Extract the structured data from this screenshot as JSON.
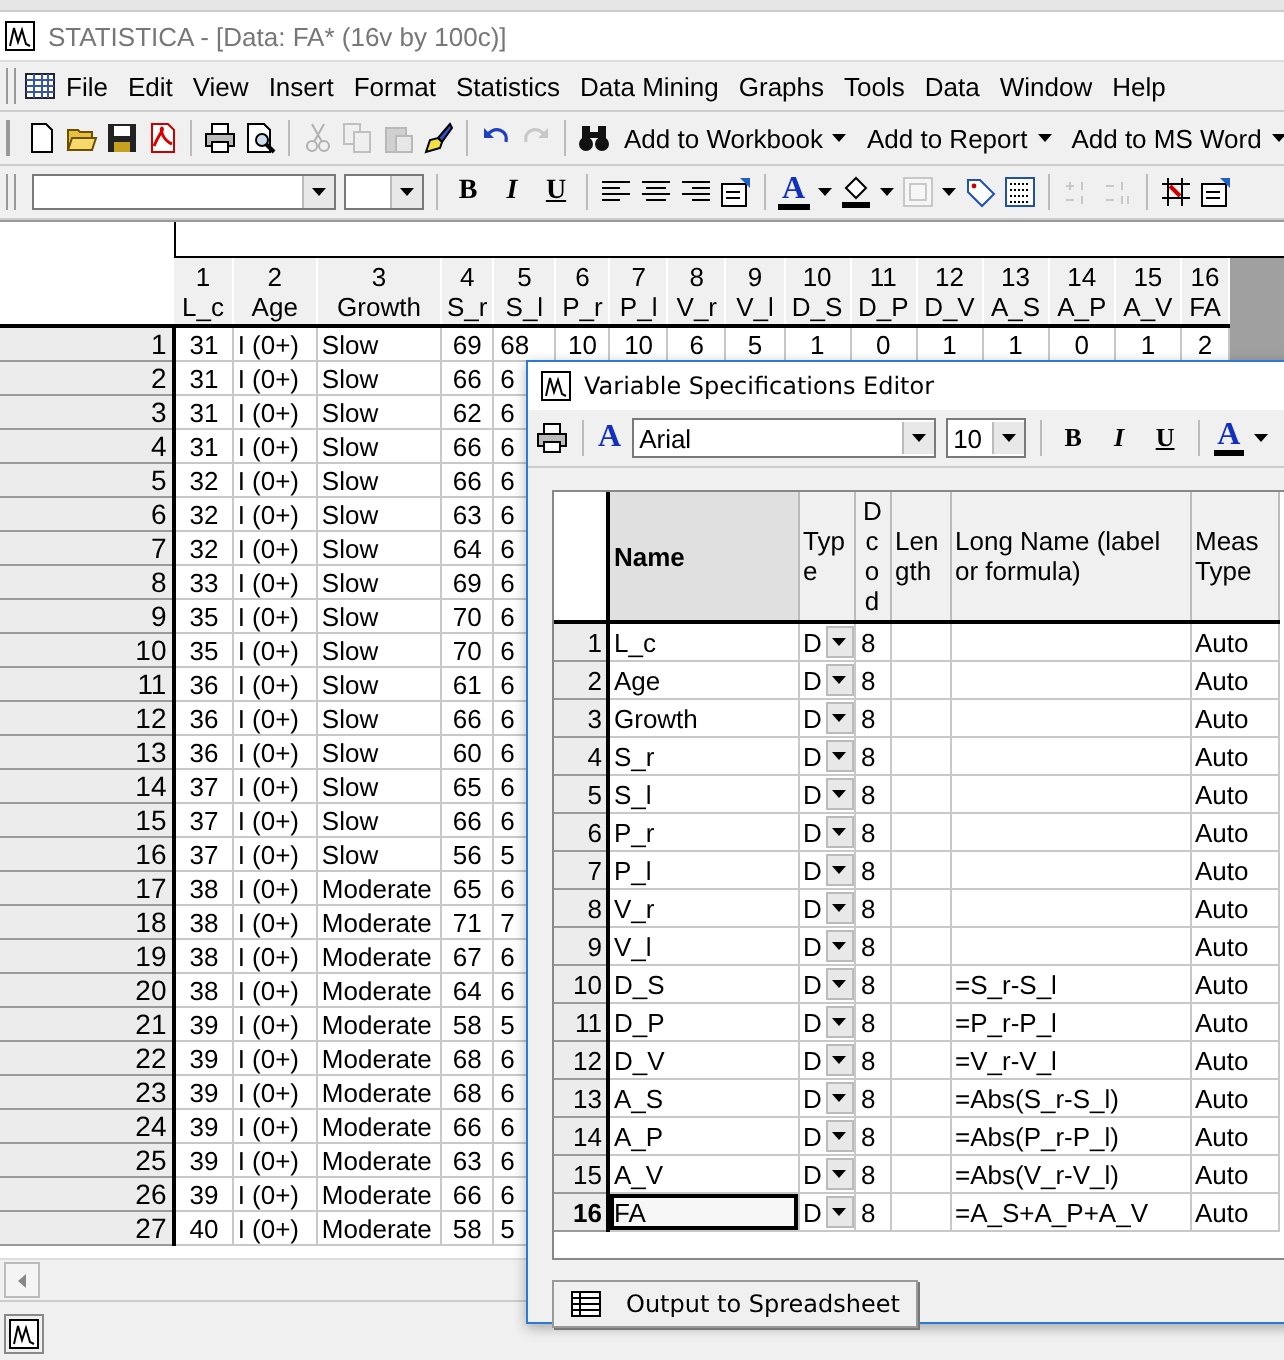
{
  "app_window": {
    "title": "STATISTICA - [Data: FA* (16v by 100c)]"
  },
  "menu": [
    {
      "label": "File"
    },
    {
      "label": "Edit"
    },
    {
      "label": "View"
    },
    {
      "label": "Insert"
    },
    {
      "label": "Format"
    },
    {
      "label": "Statistics"
    },
    {
      "label": "Data Mining"
    },
    {
      "label": "Graphs"
    },
    {
      "label": "Tools"
    },
    {
      "label": "Data"
    },
    {
      "label": "Window"
    },
    {
      "label": "Help"
    }
  ],
  "toolbar_1": {
    "icons": [
      {
        "disabled": false
      },
      {
        "disabled": false
      },
      {
        "disabled": false
      },
      {
        "disabled": false
      },
      {
        "disabled": false
      },
      {
        "disabled": false
      },
      {
        "disabled": true
      },
      {
        "disabled": true
      },
      {
        "disabled": true
      },
      {
        "disabled": false
      },
      {
        "disabled": false
      },
      {
        "disabled": true
      },
      {
        "disabled": false
      }
    ],
    "menus": [
      {
        "label": "Add to Workbook"
      },
      {
        "label": "Add to Report"
      },
      {
        "label": "Add to MS Word"
      }
    ]
  },
  "toolbar_2": {
    "bold": "B",
    "italic": "I",
    "underline": "U",
    "font_color": "A",
    "icons": [
      {
        "disabled": false
      },
      {
        "disabled": false
      },
      {
        "disabled": false
      },
      {
        "disabled": false
      },
      {
        "disabled": false
      },
      {
        "disabled": true
      },
      {
        "disabled": false
      },
      {
        "disabled": false
      },
      {
        "disabled": true
      },
      {
        "disabled": true
      },
      {
        "disabled": false
      },
      {
        "disabled": false
      }
    ]
  },
  "spreadsheet": {
    "columns": [
      {
        "number": "1",
        "name": "L_c"
      },
      {
        "number": "2",
        "name": "Age"
      },
      {
        "number": "3",
        "name": "Growth"
      },
      {
        "number": "4",
        "name": "S_r"
      },
      {
        "number": "5",
        "name": "S_l"
      },
      {
        "number": "6",
        "name": "P_r"
      },
      {
        "number": "7",
        "name": "P_l"
      },
      {
        "number": "8",
        "name": "V_r"
      },
      {
        "number": "9",
        "name": "V_l"
      },
      {
        "number": "10",
        "name": "D_S"
      },
      {
        "number": "11",
        "name": "D_P"
      },
      {
        "number": "12",
        "name": "D_V"
      },
      {
        "number": "13",
        "name": "A_S"
      },
      {
        "number": "14",
        "name": "A_P"
      },
      {
        "number": "15",
        "name": "A_V"
      },
      {
        "number": "16",
        "name": "FA"
      }
    ],
    "rows": [
      {
        "number": "1",
        "cells": [
          "31",
          "I (0+)",
          "Slow",
          "69",
          "68",
          "10",
          "10",
          "6",
          "5",
          "1",
          "0",
          "1",
          "1",
          "0",
          "1",
          "2"
        ]
      },
      {
        "number": "2",
        "cells": [
          "31",
          "I (0+)",
          "Slow",
          "66",
          "6"
        ]
      },
      {
        "number": "3",
        "cells": [
          "31",
          "I (0+)",
          "Slow",
          "62",
          "6"
        ]
      },
      {
        "number": "4",
        "cells": [
          "31",
          "I (0+)",
          "Slow",
          "66",
          "6"
        ]
      },
      {
        "number": "5",
        "cells": [
          "32",
          "I (0+)",
          "Slow",
          "66",
          "6"
        ]
      },
      {
        "number": "6",
        "cells": [
          "32",
          "I (0+)",
          "Slow",
          "63",
          "6"
        ]
      },
      {
        "number": "7",
        "cells": [
          "32",
          "I (0+)",
          "Slow",
          "64",
          "6"
        ]
      },
      {
        "number": "8",
        "cells": [
          "33",
          "I (0+)",
          "Slow",
          "69",
          "6"
        ]
      },
      {
        "number": "9",
        "cells": [
          "35",
          "I (0+)",
          "Slow",
          "70",
          "6"
        ]
      },
      {
        "number": "10",
        "cells": [
          "35",
          "I (0+)",
          "Slow",
          "70",
          "6"
        ]
      },
      {
        "number": "11",
        "cells": [
          "36",
          "I (0+)",
          "Slow",
          "61",
          "6"
        ]
      },
      {
        "number": "12",
        "cells": [
          "36",
          "I (0+)",
          "Slow",
          "66",
          "6"
        ]
      },
      {
        "number": "13",
        "cells": [
          "36",
          "I (0+)",
          "Slow",
          "60",
          "6"
        ]
      },
      {
        "number": "14",
        "cells": [
          "37",
          "I (0+)",
          "Slow",
          "65",
          "6"
        ]
      },
      {
        "number": "15",
        "cells": [
          "37",
          "I (0+)",
          "Slow",
          "66",
          "6"
        ]
      },
      {
        "number": "16",
        "cells": [
          "37",
          "I (0+)",
          "Slow",
          "56",
          "5"
        ]
      },
      {
        "number": "17",
        "cells": [
          "38",
          "I (0+)",
          "Moderate",
          "65",
          "6"
        ]
      },
      {
        "number": "18",
        "cells": [
          "38",
          "I (0+)",
          "Moderate",
          "71",
          "7"
        ]
      },
      {
        "number": "19",
        "cells": [
          "38",
          "I (0+)",
          "Moderate",
          "67",
          "6"
        ]
      },
      {
        "number": "20",
        "cells": [
          "38",
          "I (0+)",
          "Moderate",
          "64",
          "6"
        ]
      },
      {
        "number": "21",
        "cells": [
          "39",
          "I (0+)",
          "Moderate",
          "58",
          "5"
        ]
      },
      {
        "number": "22",
        "cells": [
          "39",
          "I (0+)",
          "Moderate",
          "68",
          "6"
        ]
      },
      {
        "number": "23",
        "cells": [
          "39",
          "I (0+)",
          "Moderate",
          "68",
          "6"
        ]
      },
      {
        "number": "24",
        "cells": [
          "39",
          "I (0+)",
          "Moderate",
          "66",
          "6"
        ]
      },
      {
        "number": "25",
        "cells": [
          "39",
          "I (0+)",
          "Moderate",
          "63",
          "6"
        ]
      },
      {
        "number": "26",
        "cells": [
          "39",
          "I (0+)",
          "Moderate",
          "66",
          "6"
        ]
      },
      {
        "number": "27",
        "cells": [
          "40",
          "I (0+)",
          "Moderate",
          "58",
          "5"
        ]
      }
    ]
  },
  "editor": {
    "title": "Variable Specifications Editor",
    "font": "Arial",
    "font_size": "10",
    "font_letter": "A",
    "bold": "B",
    "italic": "I",
    "underline": "U",
    "font_color": "A",
    "columns": [
      "Name",
      "Type",
      "Dcod",
      "Length",
      "Long Name (label or formula)",
      "Meas Type"
    ],
    "rows": [
      {
        "number": "1",
        "name": "L_c",
        "type": "D",
        "dcode": "8",
        "meas": "Auto",
        "selected": false
      },
      {
        "number": "2",
        "name": "Age",
        "type": "D",
        "dcode": "8",
        "meas": "Auto",
        "selected": false
      },
      {
        "number": "3",
        "name": "Growth",
        "type": "D",
        "dcode": "8",
        "meas": "Auto",
        "selected": false
      },
      {
        "number": "4",
        "name": "S_r",
        "type": "D",
        "dcode": "8",
        "meas": "Auto",
        "selected": false
      },
      {
        "number": "5",
        "name": "S_l",
        "type": "D",
        "dcode": "8",
        "meas": "Auto",
        "selected": false
      },
      {
        "number": "6",
        "name": "P_r",
        "type": "D",
        "dcode": "8",
        "meas": "Auto",
        "selected": false
      },
      {
        "number": "7",
        "name": "P_l",
        "type": "D",
        "dcode": "8",
        "meas": "Auto",
        "selected": false
      },
      {
        "number": "8",
        "name": "V_r",
        "type": "D",
        "dcode": "8",
        "meas": "Auto",
        "selected": false
      },
      {
        "number": "9",
        "name": "V_l",
        "type": "D",
        "dcode": "8",
        "meas": "Auto",
        "selected": false
      },
      {
        "number": "10",
        "name": "D_S",
        "type": "D",
        "dcode": "8",
        "long_name": "=S_r-S_l",
        "meas": "Auto",
        "selected": false
      },
      {
        "number": "11",
        "name": "D_P",
        "type": "D",
        "dcode": "8",
        "long_name": "=P_r-P_l",
        "meas": "Auto",
        "selected": false
      },
      {
        "number": "12",
        "name": "D_V",
        "type": "D",
        "dcode": "8",
        "long_name": "=V_r-V_l",
        "meas": "Auto",
        "selected": false
      },
      {
        "number": "13",
        "name": "A_S",
        "type": "D",
        "dcode": "8",
        "long_name": "=Abs(S_r-S_l)",
        "meas": "Auto",
        "selected": false
      },
      {
        "number": "14",
        "name": "A_P",
        "type": "D",
        "dcode": "8",
        "long_name": "=Abs(P_r-P_l)",
        "meas": "Auto",
        "selected": false
      },
      {
        "number": "15",
        "name": "A_V",
        "type": "D",
        "dcode": "8",
        "long_name": "=Abs(V_r-V_l)",
        "meas": "Auto",
        "selected": false
      },
      {
        "number": "16",
        "name": "FA",
        "type": "D",
        "dcode": "8",
        "long_name": "=A_S+A_P+A_V",
        "meas": "Auto",
        "selected": true
      }
    ],
    "button": "Output to Spreadsheet"
  }
}
